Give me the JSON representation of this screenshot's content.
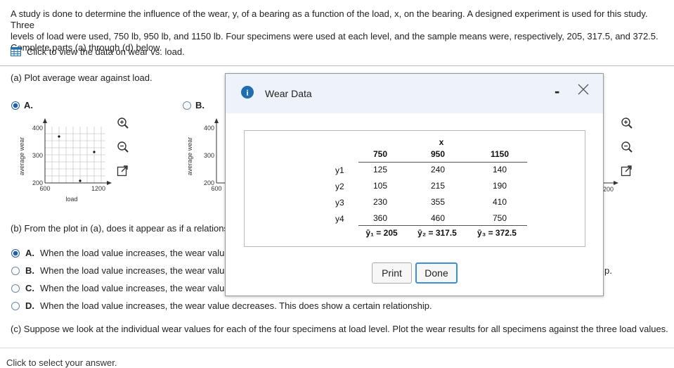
{
  "intro": {
    "line1": "A study is done to determine the influence of the wear, y, of a bearing as a function of the load, x, on the bearing. A designed experiment is used for this study. Three",
    "line2": "levels of load were used, 750 lb, 950 lb, and 1150 lb. Four specimens were used at each level, and the sample means were, respectively, 205, 317.5, and 372.5.",
    "line3": "Complete parts (a) through (d) below."
  },
  "data_link": "Click to view the data on wear vs. load.",
  "part_a": {
    "question": "(a) Plot average wear against load."
  },
  "options_a": [
    {
      "letter": "A.",
      "selected": true
    },
    {
      "letter": "B.",
      "selected": false
    }
  ],
  "graph": {
    "ylabel": "average wear",
    "xlabel": "load",
    "y_ticks": [
      "400",
      "300",
      "200"
    ],
    "x_ticks": [
      "600",
      "1200"
    ]
  },
  "graph_b": {
    "y_ticks": [
      "400",
      "300",
      "200"
    ],
    "x_ticks": [
      "600"
    ]
  },
  "right_graph": {
    "x_tick": "200"
  },
  "part_b": {
    "question": "(b) From the plot in (a), does it appear as if a relations"
  },
  "options_b": [
    {
      "letter": "A.",
      "text": "When the load value increases, the wear valu",
      "selected": true
    },
    {
      "letter": "B.",
      "text": "When the load value increases, the wear valu",
      "selected": false
    },
    {
      "letter": "C.",
      "text": "When the load value increases, the wear valu",
      "selected": false
    },
    {
      "letter": "D.",
      "text": "When the load value increases, the wear value decreases. This does show a certain relationship.",
      "selected": false
    }
  ],
  "trailing_text": "p.",
  "part_c": {
    "question": "(c) Suppose we look at the individual wear values for each of the four specimens at load level. Plot the wear results for all specimens against the three load values."
  },
  "footer": "Click to select your answer.",
  "dialog": {
    "title": "Wear Data",
    "info_icon_text": "i",
    "minimize": "-",
    "close": "X",
    "table": {
      "x_header": "x",
      "loads": [
        "750",
        "950",
        "1150"
      ],
      "rows": [
        {
          "label": "y1",
          "values": [
            "125",
            "240",
            "140"
          ]
        },
        {
          "label": "y2",
          "values": [
            "105",
            "215",
            "190"
          ]
        },
        {
          "label": "y3",
          "values": [
            "230",
            "355",
            "410"
          ]
        },
        {
          "label": "y4",
          "values": [
            "360",
            "460",
            "750"
          ]
        }
      ],
      "means": [
        "ȳ₁ = 205",
        "ȳ₂ = 317.5",
        "ȳ₃ = 372.5"
      ]
    },
    "print_label": "Print",
    "done_label": "Done"
  }
}
